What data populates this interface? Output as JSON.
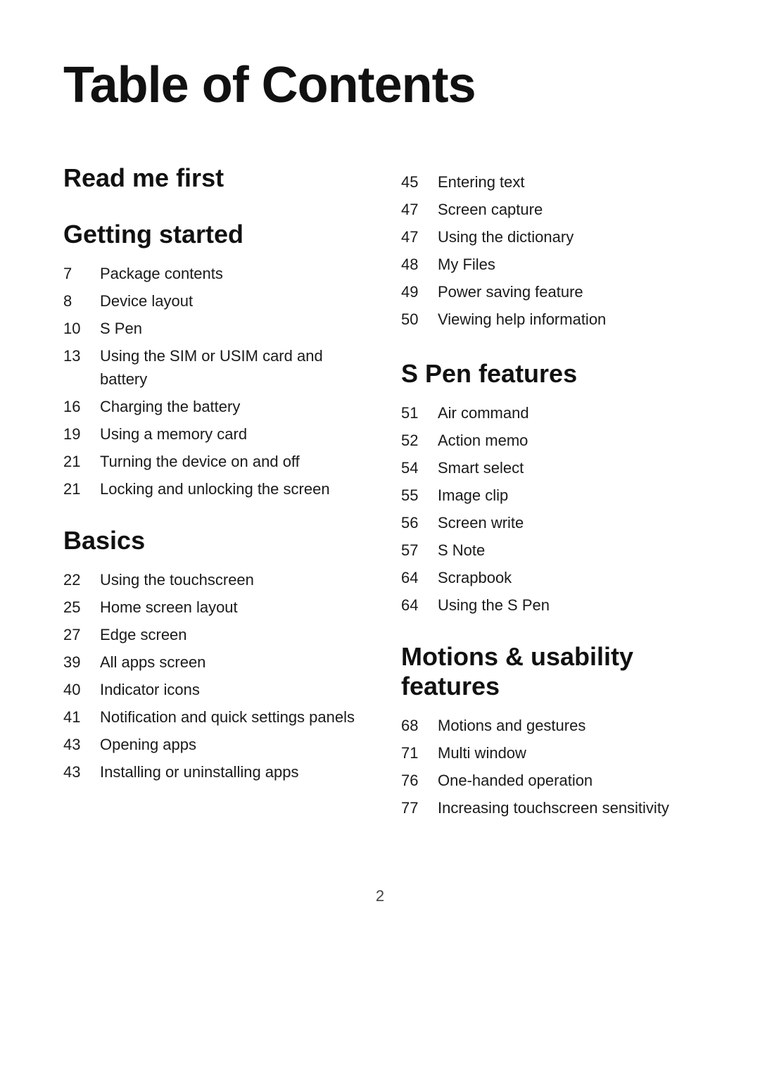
{
  "page": {
    "title": "Table of Contents",
    "footer_page": "2"
  },
  "sections": {
    "read_me_first": {
      "title": "Read me first",
      "items": []
    },
    "getting_started": {
      "title": "Getting started",
      "items": [
        {
          "page": "7",
          "label": "Package contents"
        },
        {
          "page": "8",
          "label": "Device layout"
        },
        {
          "page": "10",
          "label": "S Pen"
        },
        {
          "page": "13",
          "label": "Using the SIM or USIM card and battery"
        },
        {
          "page": "16",
          "label": "Charging the battery"
        },
        {
          "page": "19",
          "label": "Using a memory card"
        },
        {
          "page": "21",
          "label": "Turning the device on and off"
        },
        {
          "page": "21",
          "label": "Locking and unlocking the screen"
        }
      ]
    },
    "basics": {
      "title": "Basics",
      "items": [
        {
          "page": "22",
          "label": "Using the touchscreen"
        },
        {
          "page": "25",
          "label": "Home screen layout"
        },
        {
          "page": "27",
          "label": "Edge screen"
        },
        {
          "page": "39",
          "label": "All apps screen"
        },
        {
          "page": "40",
          "label": "Indicator icons"
        },
        {
          "page": "41",
          "label": "Notification and quick settings panels"
        },
        {
          "page": "43",
          "label": "Opening apps"
        },
        {
          "page": "43",
          "label": "Installing or uninstalling apps"
        }
      ]
    },
    "basics_continued": {
      "items": [
        {
          "page": "45",
          "label": "Entering text"
        },
        {
          "page": "47",
          "label": "Screen capture"
        },
        {
          "page": "47",
          "label": "Using the dictionary"
        },
        {
          "page": "48",
          "label": "My Files"
        },
        {
          "page": "49",
          "label": "Power saving feature"
        },
        {
          "page": "50",
          "label": "Viewing help information"
        }
      ]
    },
    "s_pen_features": {
      "title": "S Pen features",
      "items": [
        {
          "page": "51",
          "label": "Air command"
        },
        {
          "page": "52",
          "label": "Action memo"
        },
        {
          "page": "54",
          "label": "Smart select"
        },
        {
          "page": "55",
          "label": "Image clip"
        },
        {
          "page": "56",
          "label": "Screen write"
        },
        {
          "page": "57",
          "label": "S Note"
        },
        {
          "page": "64",
          "label": "Scrapbook"
        },
        {
          "page": "64",
          "label": "Using the S Pen"
        }
      ]
    },
    "motions_usability": {
      "title": "Motions & usability features",
      "items": [
        {
          "page": "68",
          "label": "Motions and gestures"
        },
        {
          "page": "71",
          "label": "Multi window"
        },
        {
          "page": "76",
          "label": "One-handed operation"
        },
        {
          "page": "77",
          "label": "Increasing touchscreen sensitivity"
        }
      ]
    }
  }
}
